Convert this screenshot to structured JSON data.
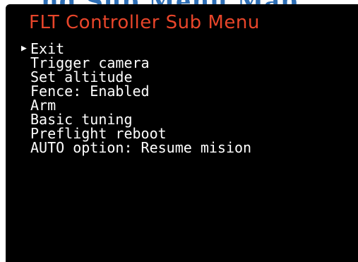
{
  "menu": {
    "title": "FLT Controller Sub Menu",
    "selected_index": 0,
    "items": [
      {
        "label": "Exit"
      },
      {
        "label": "Trigger camera"
      },
      {
        "label": "Set altitude"
      },
      {
        "label": "Fence: Enabled"
      },
      {
        "label": "Arm"
      },
      {
        "label": "Basic tuning"
      },
      {
        "label": "Preflight reboot"
      },
      {
        "label": "AUTO option: Resume mision"
      }
    ]
  },
  "colors": {
    "title": "#e8452a",
    "item_text": "#ffffff",
    "screen_bg": "#000000"
  },
  "icons": {
    "cursor": "right-pointing-triangle-icon"
  }
}
